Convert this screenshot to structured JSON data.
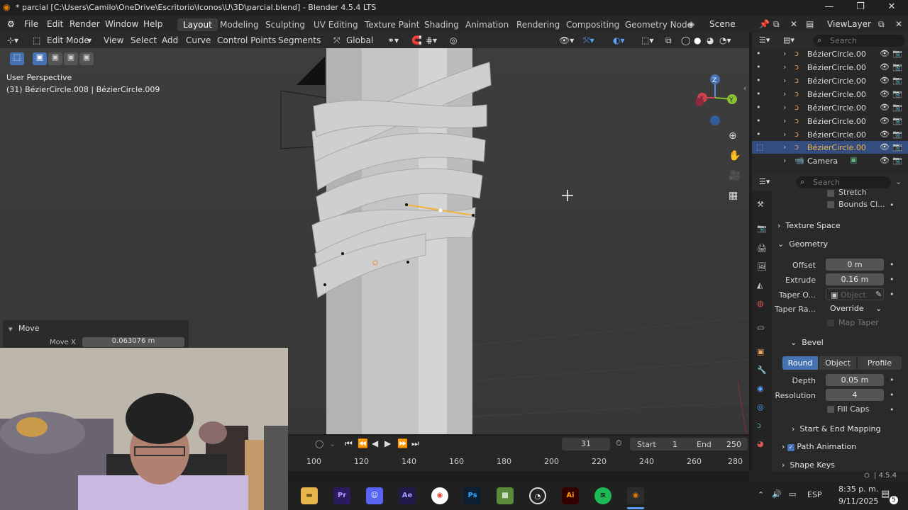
{
  "window": {
    "title": "* parcial [C:\\Users\\Camilo\\OneDrive\\Escritorio\\Iconos\\U\\3D\\parcial.blend] - Blender 4.5.4 LTS"
  },
  "menu": {
    "file": "File",
    "edit": "Edit",
    "render": "Render",
    "window": "Window",
    "help": "Help"
  },
  "workspaces": [
    "Layout",
    "Modeling",
    "Sculpting",
    "UV Editing",
    "Texture Paint",
    "Shading",
    "Animation",
    "Rendering",
    "Compositing",
    "Geometry Node"
  ],
  "scene": {
    "label": "Scene",
    "view_layer": "ViewLayer"
  },
  "viewport_header": {
    "mode": "Edit Mode",
    "view": "View",
    "select": "Select",
    "add": "Add",
    "curve": "Curve",
    "control_points": "Control Points",
    "segments": "Segments",
    "orientation": "Global"
  },
  "viewport": {
    "perspective": "User Perspective",
    "object_info": "(31) BézierCircle.008 | BézierCircle.009",
    "move_panel_title": "Move",
    "move_x_label": "Move X",
    "move_x_value": "0.063076 m"
  },
  "outliner": {
    "search_placeholder": "Search",
    "items": [
      {
        "label": "BézierCircle.00",
        "selected": false
      },
      {
        "label": "BézierCircle.00",
        "selected": false
      },
      {
        "label": "BézierCircle.00",
        "selected": false
      },
      {
        "label": "BézierCircle.00",
        "selected": false
      },
      {
        "label": "BézierCircle.00",
        "selected": false
      },
      {
        "label": "BézierCircle.00",
        "selected": false
      },
      {
        "label": "BézierCircle.00",
        "selected": false
      },
      {
        "label": "BézierCircle.00",
        "selected": true
      },
      {
        "label": "Camera",
        "selected": false
      }
    ]
  },
  "properties": {
    "search_placeholder": "Search",
    "stretch": "Stretch",
    "bounds_clamp": "Bounds Cl...",
    "texture_space": "Texture Space",
    "geometry": "Geometry",
    "offset_label": "Offset",
    "offset_value": "0 m",
    "extrude_label": "Extrude",
    "extrude_value": "0.16 m",
    "taper_obj_label": "Taper O...",
    "taper_obj_placeholder": "Object",
    "taper_radius_label": "Taper Ra...",
    "taper_radius_value": "Override",
    "map_taper": "Map Taper",
    "bevel": "Bevel",
    "bevel_round": "Round",
    "bevel_object": "Object",
    "bevel_profile": "Profile",
    "depth_label": "Depth",
    "depth_value": "0.05 m",
    "resolution_label": "Resolution",
    "resolution_value": "4",
    "fill_caps": "Fill Caps",
    "start_end_mapping": "Start & End Mapping",
    "path_animation": "Path Animation",
    "shape_keys": "Shape Keys"
  },
  "timeline": {
    "current_frame": "31",
    "start_label": "Start",
    "start_value": "1",
    "end_label": "End",
    "end_value": "250",
    "ticks": [
      "100",
      "120",
      "140",
      "160",
      "180",
      "200",
      "220",
      "240",
      "260",
      "280"
    ]
  },
  "status": {
    "version": "4.5.4"
  },
  "taskbar": {
    "apps": [
      "file-explorer",
      "premiere",
      "discord",
      "after-effects",
      "chrome",
      "photoshop",
      "minecraft",
      "obs",
      "illustrator",
      "spotify",
      "blender"
    ],
    "lang": "ESP",
    "time": "8:35 p. m.",
    "date": "9/11/2025",
    "notif_count": "5"
  },
  "colors": {
    "accent": "#4772b3",
    "selected_row": "#334d80",
    "orange": "#e8a15f"
  }
}
